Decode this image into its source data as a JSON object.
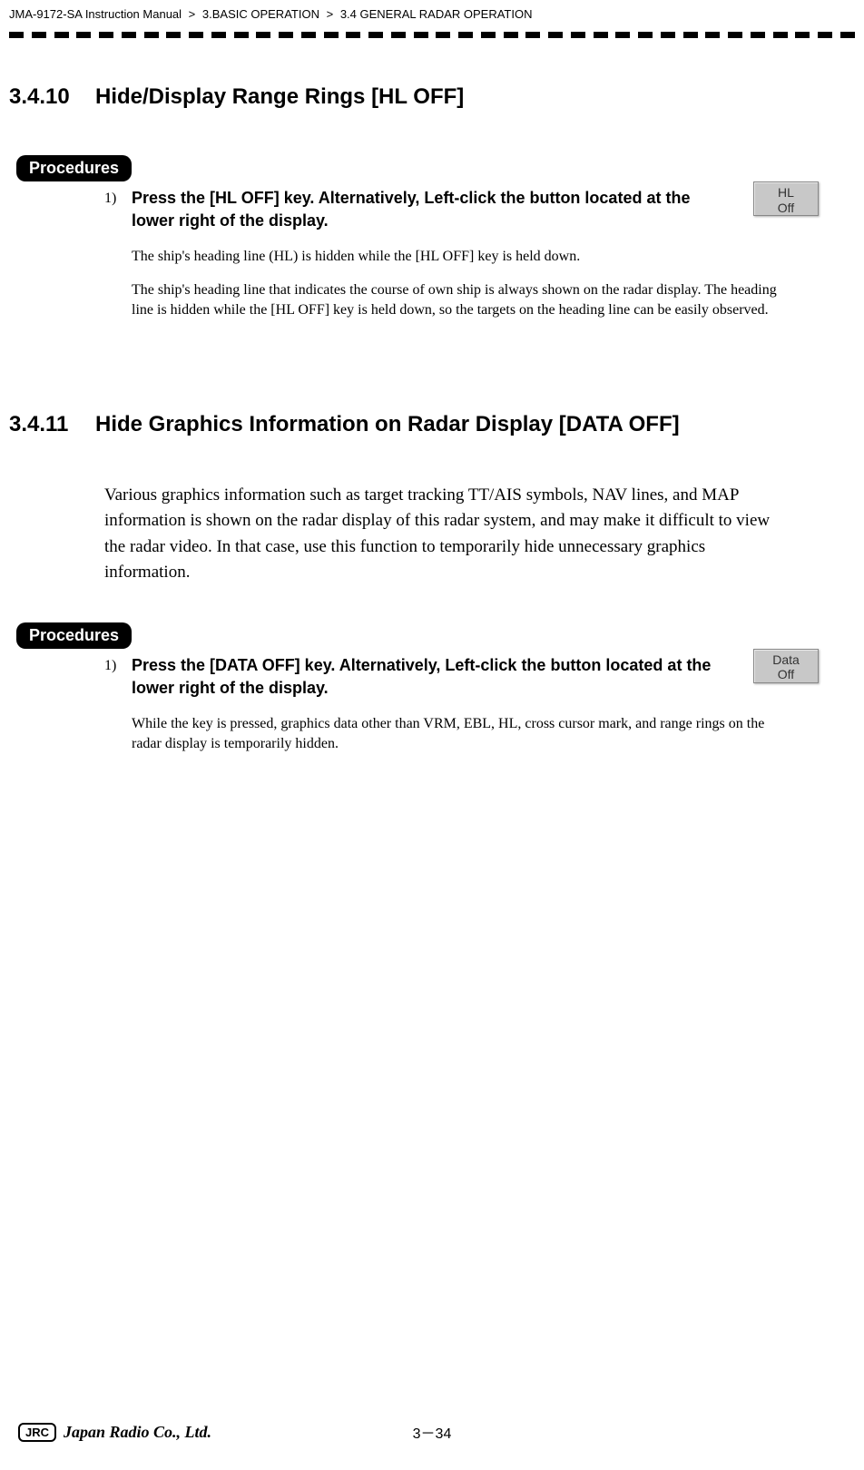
{
  "breadcrumb": {
    "part1": "JMA-9172-SA Instruction Manual",
    "sep": ">",
    "part2": "3.BASIC OPERATION",
    "part3": "3.4  GENERAL RADAR OPERATION"
  },
  "section1": {
    "num": "3.4.10",
    "title": "Hide/Display Range Rings [HL OFF]",
    "procedures_label": "Procedures",
    "step_num": "1)",
    "step_head": " Press the [HL OFF] key. Alternatively, Left-click the button located at the lower right of the display.",
    "button": "HL\nOff",
    "body1": "The ship's heading line (HL) is hidden while the [HL OFF] key is held down.",
    "body2": "The ship's heading line that indicates the course of own ship is always shown on the radar display. The heading line is hidden while the [HL OFF] key is held down, so the targets on the heading line can be easily observed."
  },
  "section2": {
    "num": "3.4.11",
    "title": "Hide Graphics Information on Radar Display [DATA OFF]",
    "intro": "Various graphics information such as target tracking TT/AIS symbols, NAV lines, and MAP information is shown on the radar display of this radar system, and may make it difficult to view the radar video. In that case, use this function to temporarily hide unnecessary graphics information.",
    "procedures_label": "Procedures",
    "step_num": "1)",
    "step_head": "Press the [DATA OFF] key. Alternatively, Left-click the button located at the lower right of the display.",
    "button": "Data\nOff",
    "body1": "While the key is pressed, graphics data other than VRM, EBL, HL, cross cursor mark, and range rings on the radar display is temporarily hidden."
  },
  "footer": {
    "jrc": "JRC",
    "company": "Japan Radio Co., Ltd.",
    "page": "3－34"
  }
}
